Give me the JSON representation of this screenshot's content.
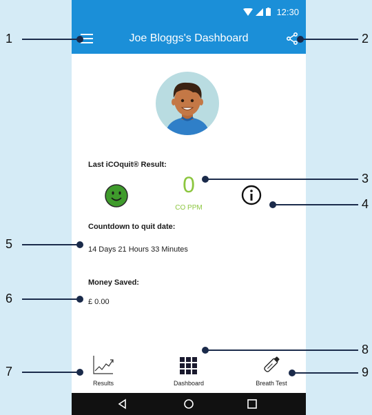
{
  "status_bar": {
    "time": "12:30"
  },
  "app_bar": {
    "title": "Joe Bloggs's Dashboard",
    "menu_icon": "hamburger-menu-icon",
    "share_icon": "share-icon"
  },
  "last_result": {
    "heading": "Last iCOquit® Result:",
    "value": "0",
    "unit": "CO PPM",
    "status_icon": "smiley-icon",
    "info_icon": "info-icon"
  },
  "countdown": {
    "heading": "Countdown to quit date:",
    "value": "14 Days 21 Hours 33 Minutes"
  },
  "money": {
    "heading": "Money Saved:",
    "value": "£ 0.00"
  },
  "bottom_nav": [
    {
      "label": "Results",
      "icon": "line-chart-icon"
    },
    {
      "label": "Dashboard",
      "icon": "grid-icon"
    },
    {
      "label": "Breath Test",
      "icon": "breath-test-device-icon"
    }
  ],
  "callouts": [
    "1",
    "2",
    "3",
    "4",
    "5",
    "6",
    "7",
    "8",
    "9"
  ],
  "colors": {
    "app_bar": "#1b8fd8",
    "accent_green": "#8cc63f",
    "background": "#d5ebf6"
  }
}
